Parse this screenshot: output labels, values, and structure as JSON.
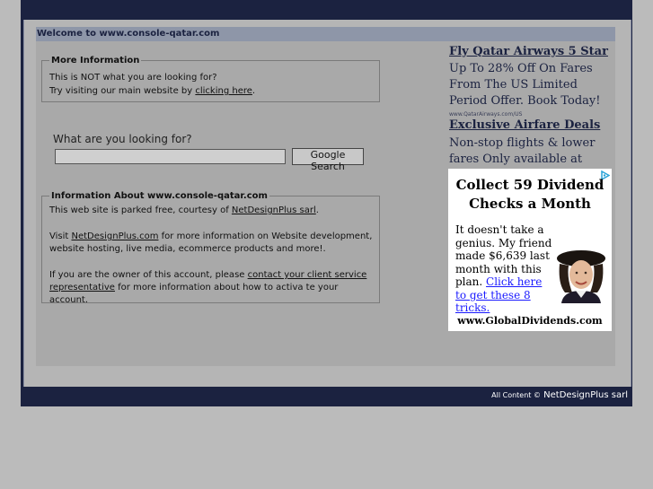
{
  "welcome": "Welcome to www.console-qatar.com",
  "more_info": {
    "legend": "More Information",
    "line1": "This is NOT what you are looking for?",
    "line2_prefix": "Try visiting our main website by ",
    "line2_link": "clicking here",
    "line2_suffix": "."
  },
  "search": {
    "label": "What are you looking for?",
    "value": "",
    "button": "Google Search"
  },
  "info": {
    "legend": "Information About www.console-qatar.com",
    "p1_prefix": "This web site is parked free, courtesy of ",
    "p1_link": "NetDesignPlus sarl",
    "p1_suffix": ".",
    "p2_prefix": "Visit ",
    "p2_link": "NetDesignPlus.com",
    "p2_suffix": " for more information on Website development, website hosting, live media, ecommerce products and more!.",
    "p3_prefix": "If you are the owner of this account, please ",
    "p3_link": "contact your client service representative",
    "p3_suffix": " for more information about how to activa te your account."
  },
  "ads": [
    {
      "title": "Fly Qatar Airways 5 Star",
      "body": "Up To 28% Off On Fares From The US Limited Period Offer. Book Today!",
      "url": "www.QatarAirways.com/US"
    },
    {
      "title": "Exclusive Airfare Deals",
      "body": "Non-stop flights & lower fares Only available at"
    }
  ],
  "banner": {
    "headline": "Collect 59 Dividend Checks a Month",
    "body_prefix": "It doesn't take a genius. My friend made $6,639 last month with this plan. ",
    "body_link": "Click here to get these 8 tricks.",
    "url": "www.GlobalDividends.com"
  },
  "footer": {
    "prefix": "All Content ©",
    "name": " NetDesignPlus sarl"
  },
  "colors": {
    "frame": "#1b2240",
    "content": "#a9a9a9",
    "header_bar": "#8e96a8"
  }
}
